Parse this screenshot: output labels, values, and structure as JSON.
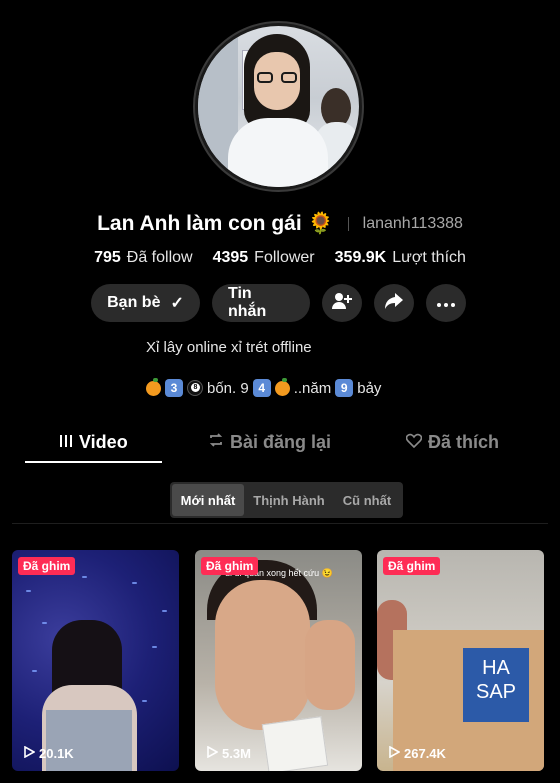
{
  "profile": {
    "display_name": "Lan Anh làm con gái 🌻",
    "username": "lananh113388",
    "stats": {
      "following_count": "795",
      "following_label": "Đã follow",
      "followers_count": "4395",
      "followers_label": "Follower",
      "likes_count": "359.9K",
      "likes_label": "Lượt thích"
    },
    "bio_line1": "Xỉ lây online xỉ trét offline",
    "bio_line2_parts": [
      "bốn. 9",
      "..năm",
      "bảy"
    ],
    "bio_keycaps": [
      "3",
      "4",
      "9"
    ]
  },
  "actions": {
    "friends_label": "Bạn bè",
    "friends_check": "✓",
    "message_label": "Tin nhắn"
  },
  "tabs": {
    "video": "Video",
    "repost": "Bài đăng lại",
    "liked": "Đã thích"
  },
  "sort": {
    "newest": "Mới nhất",
    "popular": "Thịnh Hành",
    "oldest": "Cũ nhất"
  },
  "videos": [
    {
      "badge": "Đã ghim",
      "views": "20.1K",
      "caption": ""
    },
    {
      "badge": "Đã ghim",
      "views": "5.3M",
      "caption": "đi đi quân xong hết cứu 😉"
    },
    {
      "badge": "Đã ghim",
      "views": "267.4K",
      "caption": ""
    }
  ],
  "video3_box_text": "HA SAP",
  "icons": {
    "friends": "check-icon",
    "add_friend": "add-user-icon",
    "share": "share-icon",
    "more": "more-icon",
    "video_tab": "grid-icon",
    "repost_tab": "repost-icon",
    "liked_tab": "heart-icon",
    "play": "play-icon"
  },
  "colors": {
    "background": "#000000",
    "pill": "#2b2b2b",
    "badge": "#fe2c55",
    "muted": "#8a8a8a"
  }
}
